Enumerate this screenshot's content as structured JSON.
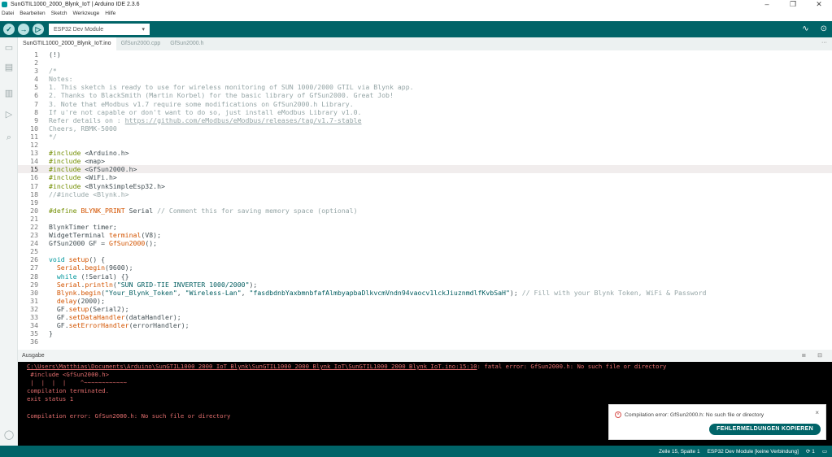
{
  "window": {
    "title": "SunGTIL1000_2000_Blynk_IoT | Arduino IDE 2.3.6",
    "minimize": "–",
    "maximize": "❐",
    "close": "✕"
  },
  "menu": [
    "Datei",
    "Bearbeiten",
    "Sketch",
    "Werkzeuge",
    "Hilfe"
  ],
  "toolbar": {
    "verify": "✓",
    "upload": "→",
    "debug": "▷",
    "board": "ESP32 Dev Module",
    "board_caret": "▾",
    "plotter": "∿",
    "monitor": "⊙"
  },
  "tabs": [
    "SunGTIL1000_2000_Blynk_IoT.ino",
    "GfSun2000.cpp",
    "GfSun2000.h"
  ],
  "tabs_more": "···",
  "current_line": 15,
  "code": [
    [
      [
        "(!)",
        "plain"
      ]
    ],
    [],
    [
      [
        "/*",
        "comment"
      ]
    ],
    [
      [
        "Notes:",
        "comment"
      ]
    ],
    [
      [
        "1. This sketch is ready to use for wireless monitoring of SUN 1000/2000 GTIL via Blynk app.",
        "comment"
      ]
    ],
    [
      [
        "2. Thanks to BlackSmith (Martin Korbel) for the basic library of GfSun2000. Great Job!",
        "comment"
      ]
    ],
    [
      [
        "3. Note that eModbus v1.7 require some modifications on GfSun2000.h Library.",
        "comment"
      ]
    ],
    [
      [
        "If u're not capable or don't want to do so, just install eModbus Library v1.0.",
        "comment"
      ]
    ],
    [
      [
        "Refer details on : ",
        "comment"
      ],
      [
        "https://github.com/eModbus/eModbus/releases/tag/v1.7-stable",
        "link"
      ]
    ],
    [
      [
        "Cheers, RBMK-5000",
        "comment"
      ]
    ],
    [
      [
        "*/",
        "comment"
      ]
    ],
    [],
    [
      [
        "#include",
        "pre"
      ],
      [
        " <Arduino.h>",
        "plain"
      ]
    ],
    [
      [
        "#include",
        "pre"
      ],
      [
        " <map>",
        "plain"
      ]
    ],
    [
      [
        "#include",
        "pre"
      ],
      [
        " <GfSun2000.h>",
        "plain"
      ]
    ],
    [
      [
        "#include",
        "pre"
      ],
      [
        " <WiFi.h>",
        "plain"
      ]
    ],
    [
      [
        "#include",
        "pre"
      ],
      [
        " <BlynkSimpleEsp32.h>",
        "plain"
      ]
    ],
    [
      [
        "//#include <Blynk.h>",
        "comment"
      ]
    ],
    [],
    [
      [
        "#define",
        "pre"
      ],
      [
        " BLYNK_PRINT",
        "fn"
      ],
      [
        " Serial ",
        "plain"
      ],
      [
        "// Comment this for saving memory space (optional)",
        "comment"
      ]
    ],
    [],
    [
      [
        "BlynkTimer timer;",
        "plain"
      ]
    ],
    [
      [
        "WidgetTerminal ",
        "plain"
      ],
      [
        "terminal",
        "fn"
      ],
      [
        "(V8);",
        "plain"
      ]
    ],
    [
      [
        "GfSun2000 GF = ",
        "plain"
      ],
      [
        "GfSun2000",
        "fn"
      ],
      [
        "();",
        "plain"
      ]
    ],
    [],
    [
      [
        "void",
        "kw"
      ],
      [
        " ",
        "plain"
      ],
      [
        "setup",
        "fn"
      ],
      [
        "() {",
        "plain"
      ]
    ],
    [
      [
        "  ",
        "plain"
      ],
      [
        "Serial",
        "fn"
      ],
      [
        ".",
        "plain"
      ],
      [
        "begin",
        "fn"
      ],
      [
        "(9600);",
        "plain"
      ]
    ],
    [
      [
        "  ",
        "plain"
      ],
      [
        "while",
        "kw"
      ],
      [
        " (!Serial) {}",
        "plain"
      ]
    ],
    [
      [
        "  ",
        "plain"
      ],
      [
        "Serial",
        "fn"
      ],
      [
        ".",
        "plain"
      ],
      [
        "println",
        "fn"
      ],
      [
        "(",
        "plain"
      ],
      [
        "\"SUN GRID-TIE INVERTER 1000/2000\"",
        "str"
      ],
      [
        ");",
        "plain"
      ]
    ],
    [
      [
        "  ",
        "plain"
      ],
      [
        "Blynk",
        "fn"
      ],
      [
        ".",
        "plain"
      ],
      [
        "begin",
        "fn"
      ],
      [
        "(",
        "plain"
      ],
      [
        "\"Your_Blynk_Token\"",
        "str"
      ],
      [
        ", ",
        "plain"
      ],
      [
        "\"Wireless-Lan\"",
        "str"
      ],
      [
        ", ",
        "plain"
      ],
      [
        "\"fasdbdnbYaxbmnbfafAlmbyapbaDlkvcmVndn94vaocv1lckJiuznmdlfKvbSaH\"",
        "str"
      ],
      [
        "); ",
        "plain"
      ],
      [
        "// Fill with your Blynk Token, WiFi & Password",
        "comment"
      ]
    ],
    [
      [
        "  ",
        "plain"
      ],
      [
        "delay",
        "fn"
      ],
      [
        "(2000);",
        "plain"
      ]
    ],
    [
      [
        "  GF.",
        "plain"
      ],
      [
        "setup",
        "fn"
      ],
      [
        "(Serial2);",
        "plain"
      ]
    ],
    [
      [
        "  GF.",
        "plain"
      ],
      [
        "setDataHandler",
        "fn"
      ],
      [
        "(dataHandler);",
        "plain"
      ]
    ],
    [
      [
        "  GF.",
        "plain"
      ],
      [
        "setErrorHandler",
        "fn"
      ],
      [
        "(errorHandler);",
        "plain"
      ]
    ],
    [
      [
        "}",
        "plain"
      ]
    ],
    []
  ],
  "output": {
    "title": "Ausgabe",
    "icons": "≣ ⊟",
    "path": "C:\\Users\\Matthias\\Documents\\Arduino\\SunGTIL1000_2000_IoT_Blynk\\SunGTIL1000_2000_Blynk_IoT\\SunGTIL1000_2000_Blynk_IoT.ino:15:10",
    "fatal": ": fatal error: GfSun2000.h: No such file or directory",
    "lines": [
      " #include <GfSun2000.h>",
      " |  |  |  |    ^~~~~~~~~~~~~",
      "compilation terminated.",
      "exit status 1",
      "",
      "Compilation error: GfSun2000.h: No such file or directory"
    ]
  },
  "toast": {
    "message": "Compilation error: GfSun2000.h: No such file or directory",
    "button": "FEHLERMELDUNGEN KOPIEREN",
    "close": "×"
  },
  "status": {
    "position": "Zeile 15, Spalte 1",
    "board": "ESP32 Dev Module [keine Verbindung]",
    "notifications": "1"
  },
  "colors": {
    "teal": "#006468",
    "error": "#e36e6e"
  }
}
